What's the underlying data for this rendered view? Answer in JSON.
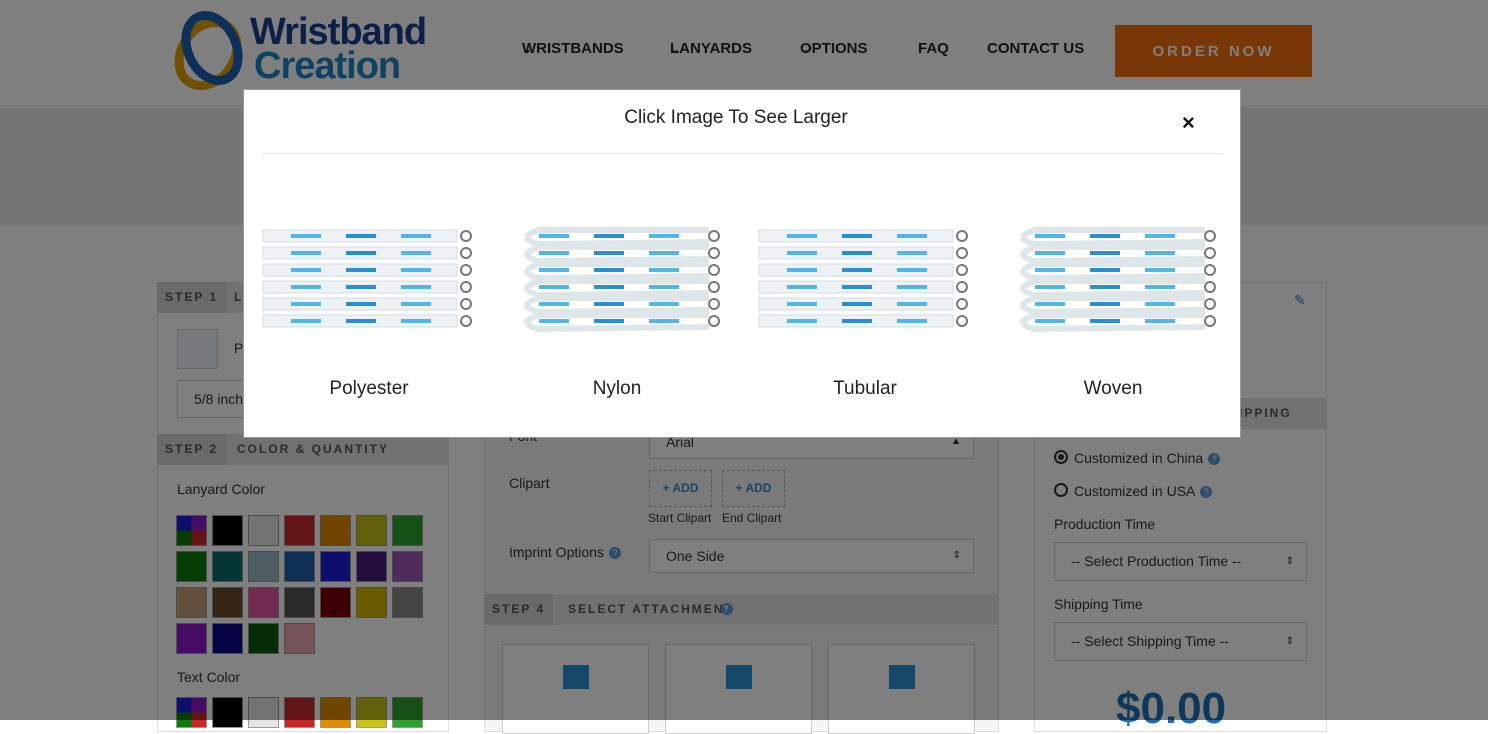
{
  "header": {
    "logo_line1": "Wristband",
    "logo_line2": "Creation",
    "nav": [
      {
        "label": "WRISTBANDS",
        "caret": "⌄"
      },
      {
        "label": "LANYARDS",
        "caret": "⌄"
      },
      {
        "label": "OPTIONS",
        "caret": "⌄"
      },
      {
        "label": "FAQ",
        "caret": ""
      },
      {
        "label": "CONTACT US",
        "caret": ""
      }
    ],
    "order_label": "ORDER NOW"
  },
  "left": {
    "step1_num": "STEP 1",
    "step1_title": "L",
    "product_value": "P",
    "size_value": "5/8 inch",
    "step2_num": "STEP 2",
    "step2_title": "COLOR & QUANTITY",
    "lanyard_color_label": "Lanyard Color",
    "text_color_label": "Text Color"
  },
  "middle": {
    "font_label": "Font",
    "font_value": "Arial",
    "clipart_label": "Clipart",
    "add_label": "+ ADD",
    "start_clipart": "Start Clipart",
    "end_clipart": "End Clipart",
    "imprint_label": "Imprint Options",
    "imprint_value": "One Side",
    "step4_num": "STEP 4",
    "step4_title": "SELECT ATTACHMENT"
  },
  "right": {
    "shipping_partial": "IPPING",
    "opt_china": "Customized in China",
    "opt_usa": "Customized in USA",
    "production_label": "Production Time",
    "production_value": "-- Select Production Time --",
    "shipping_label": "Shipping Time",
    "shipping_value": "-- Select Shipping Time --",
    "price": "$0.00"
  },
  "modal": {
    "title": "Click Image To See Larger",
    "close": "×",
    "items": [
      {
        "label": "Polyester"
      },
      {
        "label": "Nylon"
      },
      {
        "label": "Tubular"
      },
      {
        "label": "Woven"
      }
    ]
  },
  "colors": {
    "brand_orange": "#f36f0f",
    "brand_blue": "#1a3f8f",
    "lanyard_swatches": [
      "multi",
      "#000000",
      "#e6e6e6",
      "#c62828",
      "#e08a00",
      "#c9c21a",
      "#2ea02e",
      "#0a7a0a",
      "#0a6b6b",
      "#9cbcc6",
      "#1f5fa8",
      "#1a1ad6",
      "#4a1a7a",
      "#9b59b6",
      "#c4a07a",
      "#6b4a2e",
      "#e255a0",
      "#555555",
      "#7a0000",
      "#d8b800",
      "#888888",
      "#8a1acb",
      "#0a0a8a",
      "#0a5a0a",
      "#e8a5b0"
    ],
    "text_swatches": [
      "multi",
      "#000000",
      "#e6e6e6",
      "#c62828",
      "#e08a00",
      "#c9c21a",
      "#2ea02e"
    ]
  }
}
